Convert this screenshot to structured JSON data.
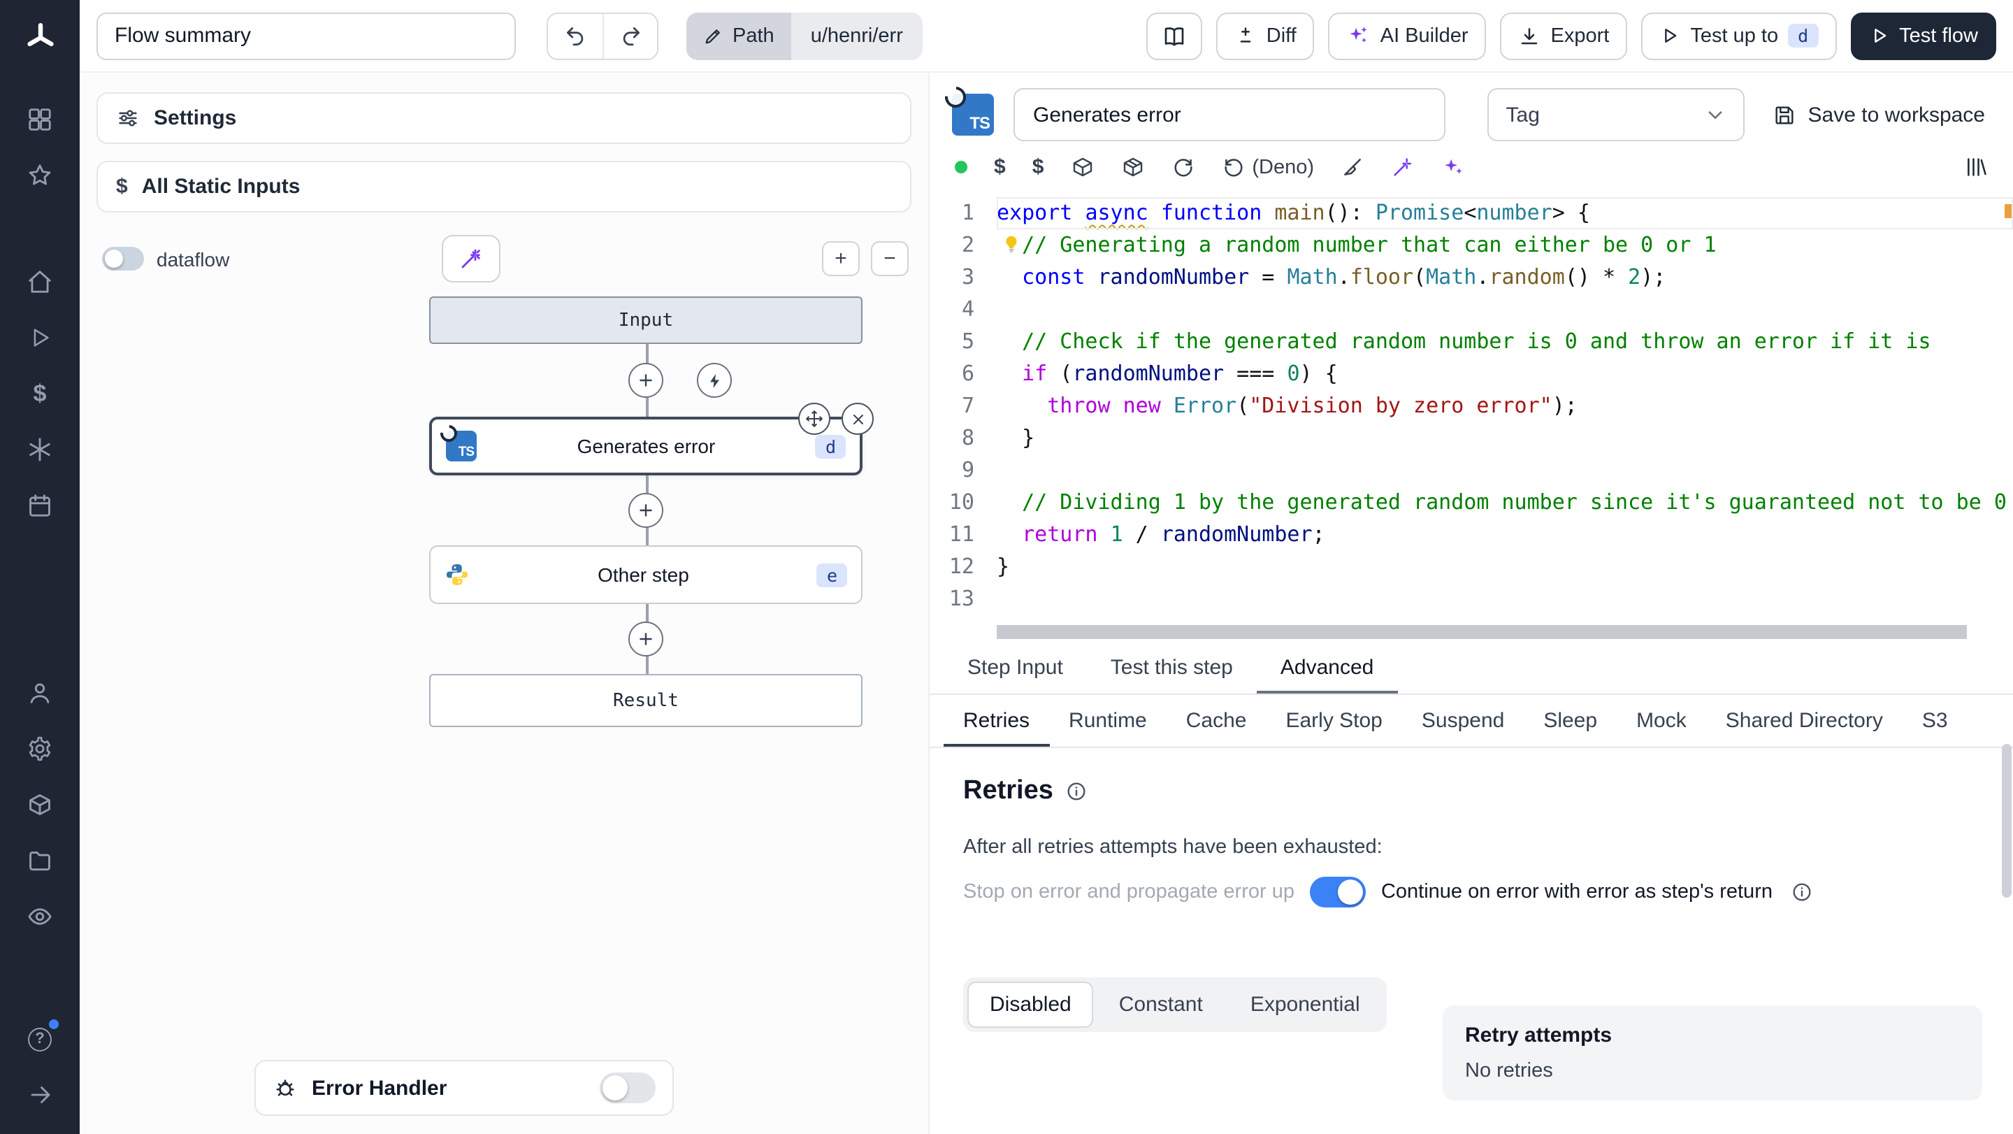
{
  "topbar": {
    "flow_summary": "Flow summary",
    "path_label": "Path",
    "path_value": "u/henri/err",
    "diff": "Diff",
    "ai_builder": "AI Builder",
    "export": "Export",
    "test_up_to": "Test up to",
    "test_up_to_badge": "d",
    "test_flow": "Test flow"
  },
  "flow_panel": {
    "settings": "Settings",
    "all_static_inputs": "All Static Inputs",
    "dataflow": "dataflow",
    "zoom_in": "+",
    "zoom_out": "−",
    "input_node": "Input",
    "step1": {
      "label": "Generates error",
      "badge": "d",
      "lang": "TS"
    },
    "step2": {
      "label": "Other step",
      "badge": "e"
    },
    "result_node": "Result",
    "error_handler": "Error Handler"
  },
  "editor": {
    "lang_badge": "TS",
    "step_name": "Generates error",
    "tag": "Tag",
    "save": "Save to workspace",
    "dollar": "$",
    "deno": "(Deno)",
    "code": {
      "bulb_line": 2,
      "lines": [
        [
          [
            "k",
            "export"
          ],
          [
            "p",
            " "
          ],
          [
            "ksq",
            "async"
          ],
          [
            "p",
            " "
          ],
          [
            "k",
            "function"
          ],
          [
            "p",
            " "
          ],
          [
            "f",
            "main"
          ],
          [
            "p",
            "(): "
          ],
          [
            "t",
            "Promise"
          ],
          [
            "p",
            "<"
          ],
          [
            "t",
            "number"
          ],
          [
            "p",
            "> {"
          ]
        ],
        [
          [
            "p",
            "  "
          ],
          [
            "c",
            "// Generating a random number that can either be 0 or 1"
          ]
        ],
        [
          [
            "p",
            "  "
          ],
          [
            "k",
            "const"
          ],
          [
            "p",
            " "
          ],
          [
            "v",
            "randomNumber"
          ],
          [
            "p",
            " = "
          ],
          [
            "t",
            "Math"
          ],
          [
            "p",
            "."
          ],
          [
            "f",
            "floor"
          ],
          [
            "p",
            "("
          ],
          [
            "t",
            "Math"
          ],
          [
            "p",
            "."
          ],
          [
            "f",
            "random"
          ],
          [
            "p",
            "() * "
          ],
          [
            "n",
            "2"
          ],
          [
            "p",
            ");"
          ]
        ],
        [],
        [
          [
            "p",
            "  "
          ],
          [
            "c",
            "// Check if the generated random number is 0 and throw an error if it is"
          ]
        ],
        [
          [
            "p",
            "  "
          ],
          [
            "cf",
            "if"
          ],
          [
            "p",
            " ("
          ],
          [
            "v",
            "randomNumber"
          ],
          [
            "p",
            " === "
          ],
          [
            "n",
            "0"
          ],
          [
            "p",
            ") {"
          ]
        ],
        [
          [
            "p",
            "    "
          ],
          [
            "cf",
            "throw"
          ],
          [
            "p",
            " "
          ],
          [
            "cf",
            "new"
          ],
          [
            "p",
            " "
          ],
          [
            "t",
            "Error"
          ],
          [
            "p",
            "("
          ],
          [
            "s",
            "\"Division by zero error\""
          ],
          [
            "p",
            ");"
          ]
        ],
        [
          [
            "p",
            "  }"
          ]
        ],
        [],
        [
          [
            "p",
            "  "
          ],
          [
            "c",
            "// Dividing 1 by the generated random number since it's guaranteed not to be 0"
          ]
        ],
        [
          [
            "p",
            "  "
          ],
          [
            "cf",
            "return"
          ],
          [
            "p",
            " "
          ],
          [
            "n",
            "1"
          ],
          [
            "p",
            " / "
          ],
          [
            "v",
            "randomNumber"
          ],
          [
            "p",
            ";"
          ]
        ],
        [
          [
            "p",
            "}"
          ]
        ],
        []
      ]
    }
  },
  "tabs": {
    "main": [
      {
        "label": "Step Input"
      },
      {
        "label": "Test this step"
      },
      {
        "label": "Advanced",
        "active": true
      }
    ],
    "advanced": [
      {
        "label": "Retries",
        "active": true
      },
      {
        "label": "Runtime"
      },
      {
        "label": "Cache"
      },
      {
        "label": "Early Stop"
      },
      {
        "label": "Suspend"
      },
      {
        "label": "Sleep"
      },
      {
        "label": "Mock"
      },
      {
        "label": "Shared Directory"
      },
      {
        "label": "S3"
      }
    ]
  },
  "retries": {
    "title": "Retries",
    "intro": "After all retries attempts have been exhausted:",
    "stop_label": "Stop on error and propagate error up",
    "continue_label": "Continue on error with error as step's return",
    "modes": [
      {
        "label": "Disabled",
        "active": true
      },
      {
        "label": "Constant"
      },
      {
        "label": "Exponential"
      }
    ],
    "attempts_title": "Retry attempts",
    "attempts_value": "No retries"
  },
  "icons": {
    "sidebar": [
      "windmill-logo",
      "apps-icon",
      "favorites-star-icon",
      "home-icon",
      "runs-icon",
      "variables-icon",
      "resources-icon",
      "schedules-icon",
      "users-icon",
      "settings-gear-icon",
      "workers-icon",
      "folders-icon",
      "audit-eye-icon",
      "help-icon",
      "expand-sidebar-icon"
    ],
    "help_glyph": "?"
  },
  "colors": {
    "sidebar_bg": "#1f2532",
    "accent_blue": "#3b82f6",
    "badge_bg": "#dbe4fd",
    "badge_text": "#1e3a8a",
    "dark_button": "#1e2736",
    "violet": "#7c3aed",
    "status_green": "#22c55e"
  }
}
